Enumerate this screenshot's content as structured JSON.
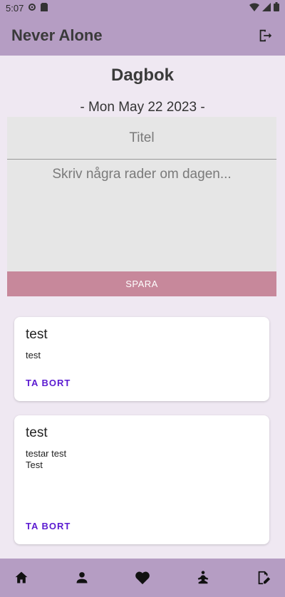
{
  "status": {
    "time": "5:07"
  },
  "app": {
    "title": "Never Alone"
  },
  "page": {
    "title": "Dagbok",
    "date": "- Mon May 22 2023 -"
  },
  "editor": {
    "title_placeholder": "Titel",
    "body_placeholder": "Skriv några rader om dagen...",
    "save_label": "SPARA"
  },
  "entries": [
    {
      "title": "test",
      "body": "test",
      "delete_label": "TA BORT"
    },
    {
      "title": "test",
      "body": "testar test\nTest",
      "delete_label": "TA BORT"
    }
  ],
  "nav": {
    "items": [
      "home-icon",
      "profile-icon",
      "heart-icon",
      "meditation-icon",
      "edit-icon"
    ]
  },
  "colors": {
    "bar": "#b59dc3",
    "save": "#c7889b",
    "accent": "#5b1bd1"
  }
}
